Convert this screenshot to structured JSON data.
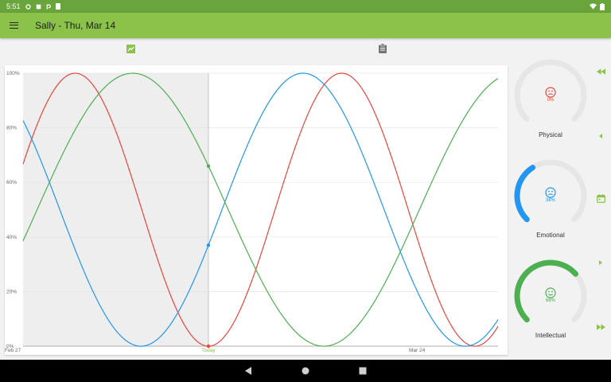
{
  "status_bar": {
    "time": "5:51"
  },
  "app_bar": {
    "title": "Sally - Thu, Mar 14"
  },
  "tabs": [
    {
      "icon": "chart-icon",
      "active": true
    },
    {
      "icon": "clipboard-icon",
      "active": false
    }
  ],
  "colors": {
    "physical": "#e8453c",
    "emotional": "#2196f3",
    "intellectual": "#4caf50",
    "accent": "#8bc34a"
  },
  "gauges": {
    "physical": {
      "label": "Physical",
      "percent_text": "0%",
      "value": 0,
      "face": "sad-face-icon",
      "color": "#e8453c"
    },
    "emotional": {
      "label": "Emotional",
      "percent_text": "38%",
      "value": 38,
      "face": "sad-face-icon",
      "color": "#2196f3"
    },
    "intellectual": {
      "label": "Intellectual",
      "percent_text": "68%",
      "value": 68,
      "face": "smile-face-icon",
      "color": "#4caf50"
    }
  },
  "side_nav": [
    {
      "icon": "fast-rewind-icon"
    },
    {
      "icon": "step-back-icon"
    },
    {
      "icon": "calendar-icon"
    },
    {
      "icon": "step-forward-icon"
    },
    {
      "icon": "fast-forward-icon"
    }
  ],
  "chart_data": {
    "type": "line",
    "y_tick_labels": [
      "0%",
      "20%",
      "40%",
      "60%",
      "80%",
      "100%"
    ],
    "ylim": [
      0,
      100
    ],
    "x_tick_labels": [
      "Feb 27",
      "Today",
      "Mar 24"
    ],
    "x_days_shown": 41,
    "today_day_index": 16,
    "past_shaded": true,
    "series": [
      {
        "key": "physical",
        "color": "#e8453c",
        "period_days": 23,
        "today_value": 0,
        "rising_after_today": true
      },
      {
        "key": "emotional",
        "color": "#2196f3",
        "period_days": 28,
        "today_value": 37,
        "rising_after_today": true
      },
      {
        "key": "intellectual",
        "color": "#4caf50",
        "period_days": 33,
        "today_value": 66,
        "rising_after_today": false
      }
    ]
  }
}
